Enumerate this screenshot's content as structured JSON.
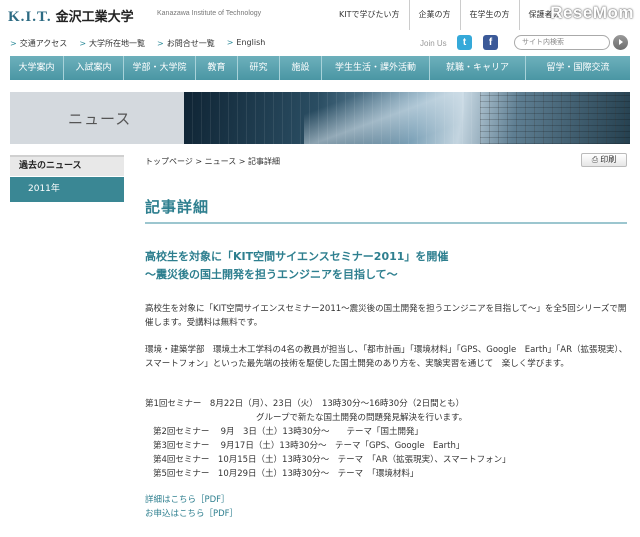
{
  "header": {
    "logo_kit": "K.I.T.",
    "logo_jp": "金沢工業大学",
    "logo_en": "Kanazawa Institute of Technology",
    "top_links": [
      "KITで学びたい方",
      "企業の方",
      "在学生の方",
      "保護者の"
    ],
    "watermark": "ReseMom",
    "sub_links": [
      "交通アクセス",
      "大学所在地一覧",
      "お問合せ一覧",
      "English"
    ],
    "join_us": "Join Us",
    "twitter": "t",
    "facebook": "f",
    "search_placeholder": "サイト内検索"
  },
  "nav": {
    "items": [
      "大学案内",
      "入試案内",
      "学部・大学院",
      "教育",
      "研究",
      "施設",
      "学生生活・課外活動",
      "就職・キャリア",
      "留学・国際交流"
    ]
  },
  "banner": {
    "title": "ニュース"
  },
  "sidebar": {
    "heading": "過去のニュース",
    "item": "2011年"
  },
  "content": {
    "breadcrumb": "トップページ > ニュース > 記事詳細",
    "print_label": "印刷",
    "page_title": "記事詳細",
    "headline_1": "高校生を対象に「KIT空間サイエンスセミナー2011」を開催",
    "headline_2": "～震災後の国土開発を担うエンジニアを目指して～",
    "para_1": "高校生を対象に「KIT空間サイエンスセミナー2011～震災後の国土開発を担うエンジニアを目指して～」を全5回シリーズで開催します。受講料は無料です。",
    "para_2": "環境・建築学部　環境土木工学科の4名の教員が担当し、「都市計画」「環境材料」「GPS、Google　Earth」「AR（拡張現実）、スマートフォン」といった最先端の技術を駆使した国土開発のあり方を、実験実習を通じて　楽しく学びます。",
    "schedule": [
      "第1回セミナー　8月22日（月）、23日（火）　13時30分～16時30分（2日間とも）",
      "グループで新たな国土開発の問題発見解決を行います。",
      "第2回セミナー　 9月　3日（土）13時30分～　　テーマ「国土開発」",
      "第3回セミナー　 9月17日（土）13時30分～　テーマ「GPS、Google　Earth」",
      "第4回セミナー　10月15日（土）13時30分～　テーマ　「AR（拡張現実）、スマートフォン」",
      "第5回セミナー　10月29日（土）13時30分～　テーマ　「環境材料」"
    ],
    "link_details": "詳細はこちら［PDF］",
    "link_apply": "お申込はこちら［PDF］"
  },
  "colors": {
    "accent": "#2e7f8f",
    "nav": "#4a96a4",
    "sidebar_active": "#3a8794"
  }
}
